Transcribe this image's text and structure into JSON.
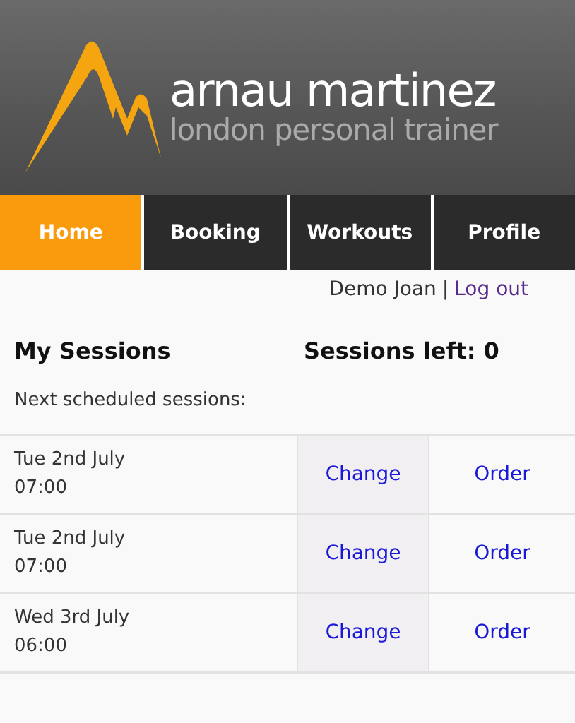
{
  "header": {
    "name": "arnau martinez",
    "tagline": "london personal trainer"
  },
  "tabs": [
    {
      "label": "Home",
      "selected": true
    },
    {
      "label": "Booking",
      "selected": false
    },
    {
      "label": "Workouts",
      "selected": false
    },
    {
      "label": "Profile",
      "selected": false
    }
  ],
  "user": {
    "name": "Demo Joan",
    "separator": "|",
    "logout": "Log out"
  },
  "title": "My Sessions",
  "sessions_left": "Sessions left: 0",
  "subtitle": "Next scheduled sessions:",
  "sessions": [
    {
      "date": "Tue 2nd July",
      "time": "07:00",
      "change": "Change",
      "order": "Order"
    },
    {
      "date": "Tue 2nd July",
      "time": "07:00",
      "change": "Change",
      "order": "Order"
    },
    {
      "date": "Wed 3rd July",
      "time": "06:00",
      "change": "Change",
      "order": "Order"
    }
  ]
}
